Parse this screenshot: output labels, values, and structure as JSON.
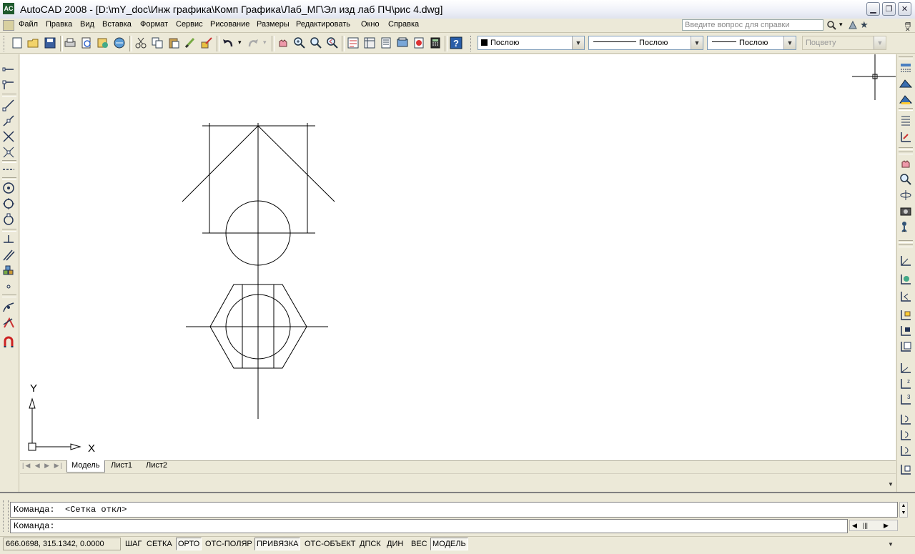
{
  "window": {
    "title": "AutoCAD 2008 - [D:\\mY_doc\\Инж графика\\Комп Графика\\Лаб_МГ\\Эл изд лаб ПЧ\\рис 4.dwg]",
    "app_icon_label": "AC",
    "controls": [
      "minimize-icon",
      "restore-icon",
      "close-icon"
    ]
  },
  "menubar": {
    "items": [
      "Файл",
      "Правка",
      "Вид",
      "Вставка",
      "Формат",
      "Сервис",
      "Рисование",
      "Размеры",
      "Редактировать",
      "Окно",
      "Справка"
    ],
    "help_placeholder": "Введите вопрос для справки"
  },
  "properties": {
    "color": "Послою",
    "linetype": "Послою",
    "lineweight": "Послою",
    "plotstyle": "Поцвету"
  },
  "ucs": {
    "x_label": "X",
    "y_label": "Y"
  },
  "layout_tabs": [
    "Модель",
    "Лист1",
    "Лист2"
  ],
  "command": {
    "history_line": "Команда:  <Сетка откл>",
    "prompt": "Команда:"
  },
  "status": {
    "coordinates": "666.0698, 315.1342, 0.0000",
    "toggles": [
      {
        "label": "ШАГ",
        "on": false
      },
      {
        "label": "СЕТКА",
        "on": false
      },
      {
        "label": "ОРТО",
        "on": true
      },
      {
        "label": "ОТС-ПОЛЯР",
        "on": false
      },
      {
        "label": "ПРИВЯЗКА",
        "on": true
      },
      {
        "label": "ОТС-ОБЪЕКТ",
        "on": false
      },
      {
        "label": "ДПСК",
        "on": false
      },
      {
        "label": "ДИН",
        "on": false
      },
      {
        "label": "ВЕС",
        "on": false
      },
      {
        "label": "МОДЕЛЬ",
        "on": true
      }
    ]
  }
}
